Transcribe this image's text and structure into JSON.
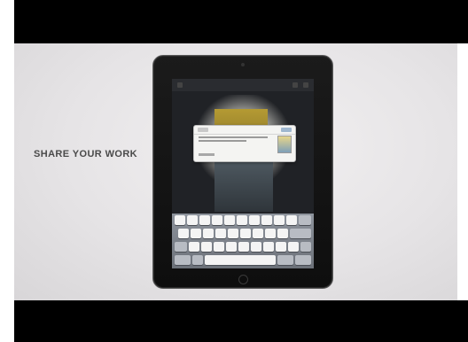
{
  "caption": "SHARE YOUR WORK",
  "colors": {
    "letterbox": "#000000",
    "backdrop": "#e6e4e6",
    "device": "#111111",
    "keyboard": "#7d828a"
  },
  "icons": [
    "camera-icon",
    "home-button-icon"
  ]
}
